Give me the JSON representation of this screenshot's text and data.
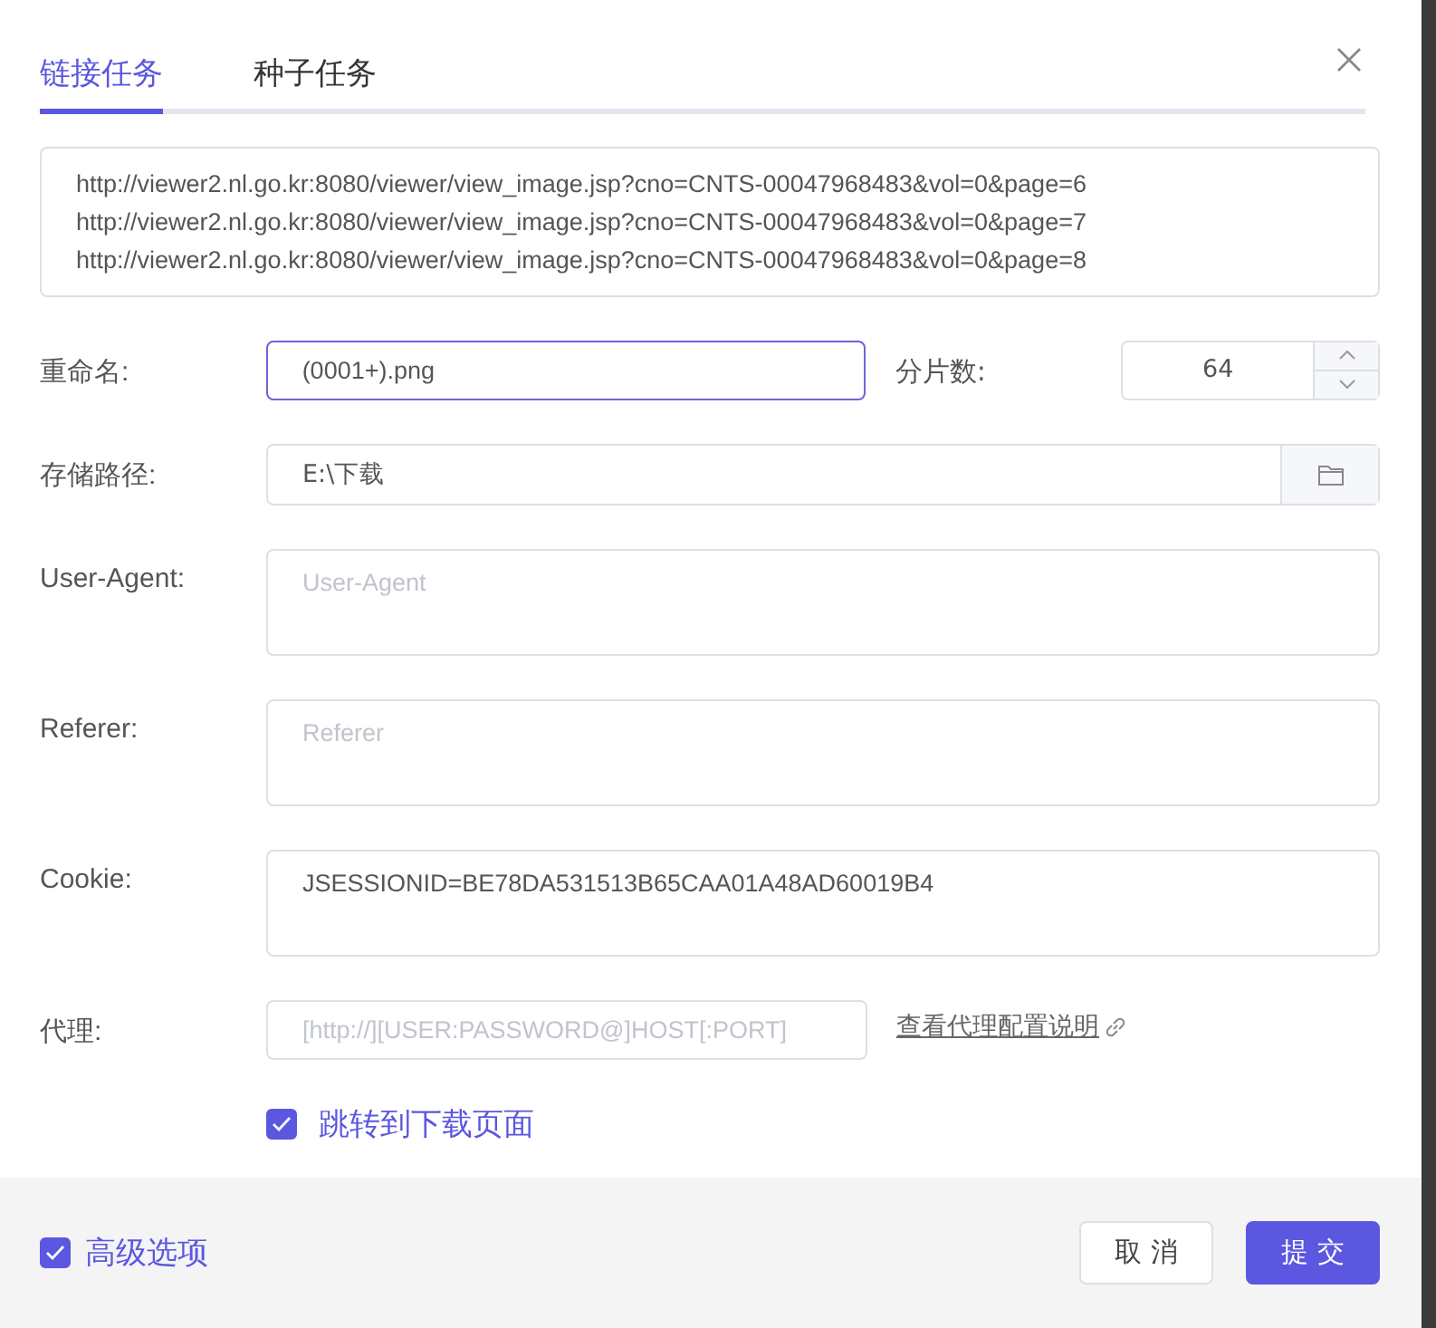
{
  "tabs": [
    {
      "label": "链接任务",
      "selected": true
    },
    {
      "label": "种子任务",
      "selected": false
    }
  ],
  "urls": [
    "http://viewer2.nl.go.kr:8080/viewer/view_image.jsp?cno=CNTS-00047968483&vol=0&page=6",
    "http://viewer2.nl.go.kr:8080/viewer/view_image.jsp?cno=CNTS-00047968483&vol=0&page=7",
    "http://viewer2.nl.go.kr:8080/viewer/view_image.jsp?cno=CNTS-00047968483&vol=0&page=8"
  ],
  "rename": {
    "label": "重命名:",
    "value": "(0001+).png",
    "focused": true
  },
  "segments": {
    "label": "分片数:",
    "value": "64"
  },
  "save_path": {
    "label": "存储路径:",
    "value": "E:\\下载"
  },
  "user_agent": {
    "label": "User-Agent:",
    "placeholder": "User-Agent"
  },
  "referer": {
    "label": "Referer:",
    "placeholder": "Referer"
  },
  "cookie": {
    "label": "Cookie:",
    "value": "JSESSIONID=BE78DA531513B65CAA01A48AD60019B4"
  },
  "proxy": {
    "label": "代理:",
    "placeholder": "[http://][USER:PASSWORD@]HOST[:PORT]",
    "link": "查看代理配置说明"
  },
  "jump": {
    "label": "跳转到下载页面",
    "checked": true
  },
  "advanced": {
    "label": "高级选项",
    "checked": true
  },
  "buttons": [
    {
      "label": "取 消",
      "kind": "secondary"
    },
    {
      "label": "提 交",
      "kind": "primary"
    }
  ]
}
